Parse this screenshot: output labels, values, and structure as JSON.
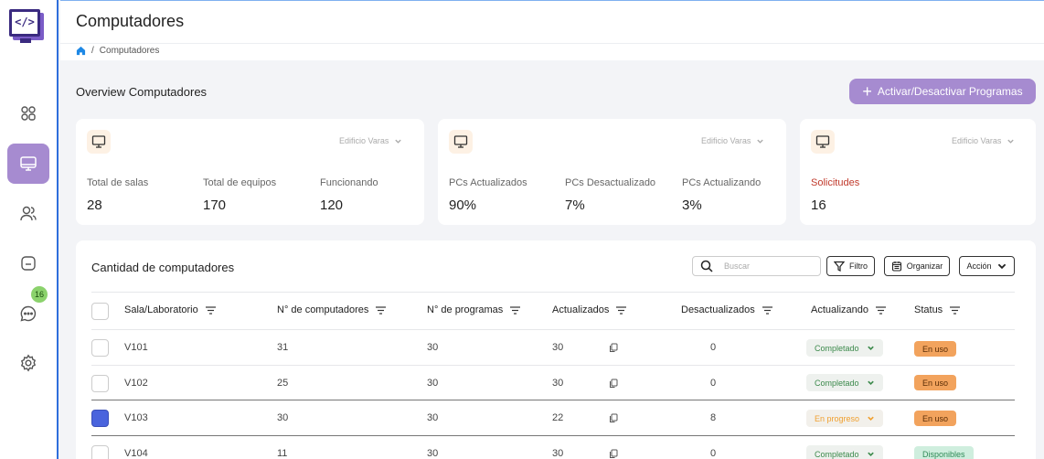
{
  "header": {
    "title": "Computadores",
    "breadcrumb": "Computadores"
  },
  "sidebar": {
    "icons": [
      "grid-icon",
      "monitor-icon",
      "users-icon",
      "folder-icon",
      "chat-icon",
      "gear-icon"
    ],
    "chat_badge": "16"
  },
  "overview": {
    "title": "Overview Computadores",
    "action_label": "Activar/Desactivar Programas"
  },
  "cards": [
    {
      "building": "Edificio Varas",
      "stats": [
        {
          "label": "Total de salas",
          "value": "28"
        },
        {
          "label": "Total de equipos",
          "value": "170"
        },
        {
          "label": "Funcionando",
          "value": "120"
        }
      ]
    },
    {
      "building": "Edificio Varas",
      "stats": [
        {
          "label": "PCs Actualizados",
          "value": "90%"
        },
        {
          "label": "PCs Desactualizado",
          "value": "7%"
        },
        {
          "label": "PCs Actualizando",
          "value": "3%"
        }
      ]
    },
    {
      "building": "Edificio Varas",
      "stats": [
        {
          "label": "Solicitudes",
          "value": "16"
        }
      ]
    }
  ],
  "table": {
    "title": "Cantidad de computadores",
    "search_placeholder": "Buscar",
    "filter_label": "Filtro",
    "organize_label": "Organizar",
    "action_label": "Acción",
    "columns": [
      "Sala/Laboratorio",
      "N° de computadores",
      "N° de programas",
      "Actualizados",
      "Desactualizados",
      "Actualizando",
      "Status"
    ],
    "rows": [
      {
        "room": "V101",
        "computers": "31",
        "programs": "30",
        "updated": "30",
        "outdated": "0",
        "updating": "Completado",
        "status": "En uso",
        "checked": false
      },
      {
        "room": "V102",
        "computers": "25",
        "programs": "30",
        "updated": "30",
        "outdated": "0",
        "updating": "Completado",
        "status": "En uso",
        "checked": false
      },
      {
        "room": "V103",
        "computers": "30",
        "programs": "30",
        "updated": "22",
        "outdated": "8",
        "updating": "En progreso",
        "status": "En uso",
        "checked": true
      },
      {
        "room": "V104",
        "computers": "11",
        "programs": "30",
        "updated": "30",
        "outdated": "0",
        "updating": "Completado",
        "status": "Disponibles",
        "checked": false
      }
    ]
  },
  "colors": {
    "accent": "#a68bd0",
    "selected_checkbox": "#4a64dd",
    "in_use": "#f2a35d",
    "available": "#cfeede",
    "completed_text": "#3c8a4c",
    "in_progress_text": "#f0a030",
    "requests_label": "#c0392b"
  }
}
